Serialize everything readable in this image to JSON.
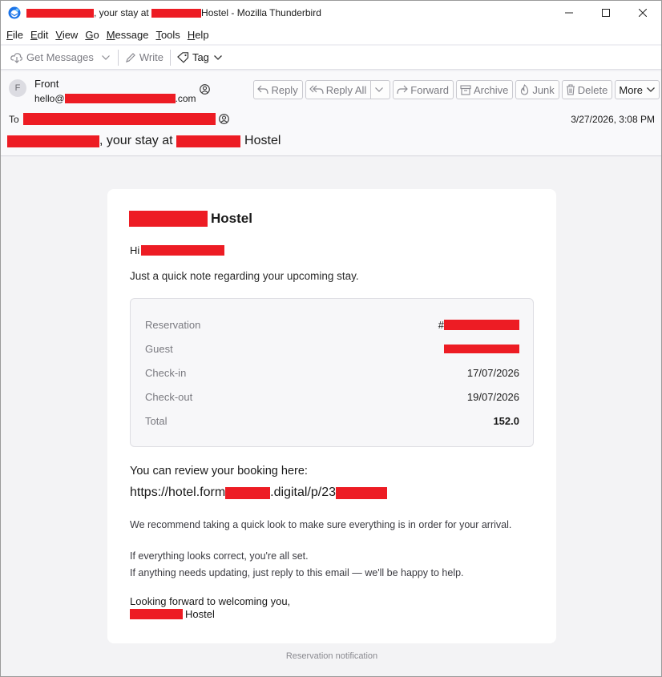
{
  "window": {
    "title_middle": ", your stay at ",
    "title_suffix": "Hostel - Mozilla Thunderbird",
    "minimize_glyph": "—",
    "maximize_glyph": "☐",
    "close_glyph": "✕"
  },
  "menu": [
    "File",
    "Edit",
    "View",
    "Go",
    "Message",
    "Tools",
    "Help"
  ],
  "toolbar": {
    "get_messages": "Get Messages",
    "write": "Write",
    "tag": "Tag"
  },
  "message_header": {
    "avatar_initial": "F",
    "from_name": "Front",
    "from_email_prefix": "hello@",
    "from_email_suffix": ".com",
    "to_label": "To",
    "date": "3/27/2026, 3:08 PM",
    "subject_middle": ", your stay at ",
    "subject_suffix": "Hostel",
    "actions": {
      "reply": "Reply",
      "reply_all": "Reply All",
      "forward": "Forward",
      "archive": "Archive",
      "junk": "Junk",
      "delete": "Delete",
      "more": "More"
    }
  },
  "email": {
    "brand_suffix": "Hostel",
    "greeting": "Hi",
    "intro": "Just a quick note regarding your upcoming stay.",
    "reservation": {
      "rows": [
        {
          "label": "Reservation",
          "value": "#"
        },
        {
          "label": "Guest",
          "value": ""
        },
        {
          "label": "Check-in",
          "value": "17/07/2026"
        },
        {
          "label": "Check-out",
          "value": "19/07/2026"
        },
        {
          "label": "Total",
          "value": "152.0"
        }
      ]
    },
    "review_text": "You can review your booking here:",
    "link_part1": "https://hotel.form",
    "link_part2": ".digital/p/23",
    "para1": "We recommend taking a quick look to make sure everything is in order for your arrival.",
    "para2_line1": "If everything looks correct, you're all set.",
    "para2_line2": "If anything needs updating, just reply to this email — we'll be happy to help.",
    "closing": "Looking forward to welcoming you,",
    "signature_suffix": "Hostel",
    "footer": "Reservation notification"
  },
  "colors": {
    "redaction": "#ed1c24",
    "thunderbird_blue": "#0a84ff"
  }
}
